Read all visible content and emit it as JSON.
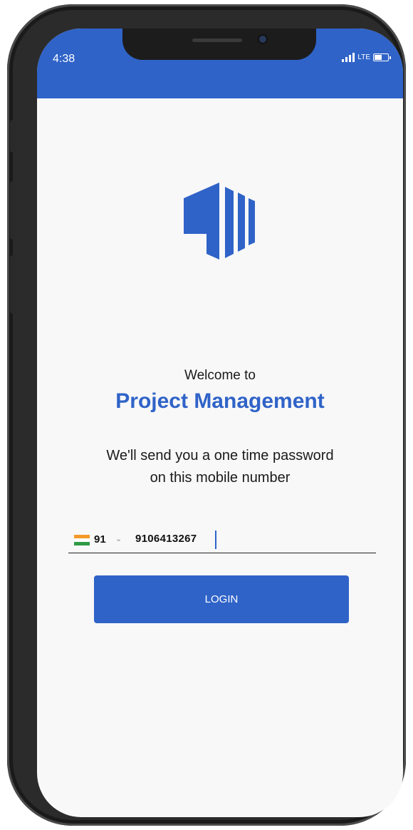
{
  "status": {
    "time": "4:38",
    "network": "LTE"
  },
  "welcome_text": "Welcome to",
  "app_title": "Project Management",
  "subtitle_line1": "We'll send you a one time password",
  "subtitle_line2": "on this mobile number",
  "phone": {
    "country_code": "91",
    "number": "9106413267"
  },
  "login_label": "LOGIN",
  "colors": {
    "primary": "#2f63c8"
  },
  "icons": [
    "signal-icon",
    "battery-icon",
    "app-logo-icon",
    "india-flag-icon",
    "chevron-down-icon"
  ]
}
